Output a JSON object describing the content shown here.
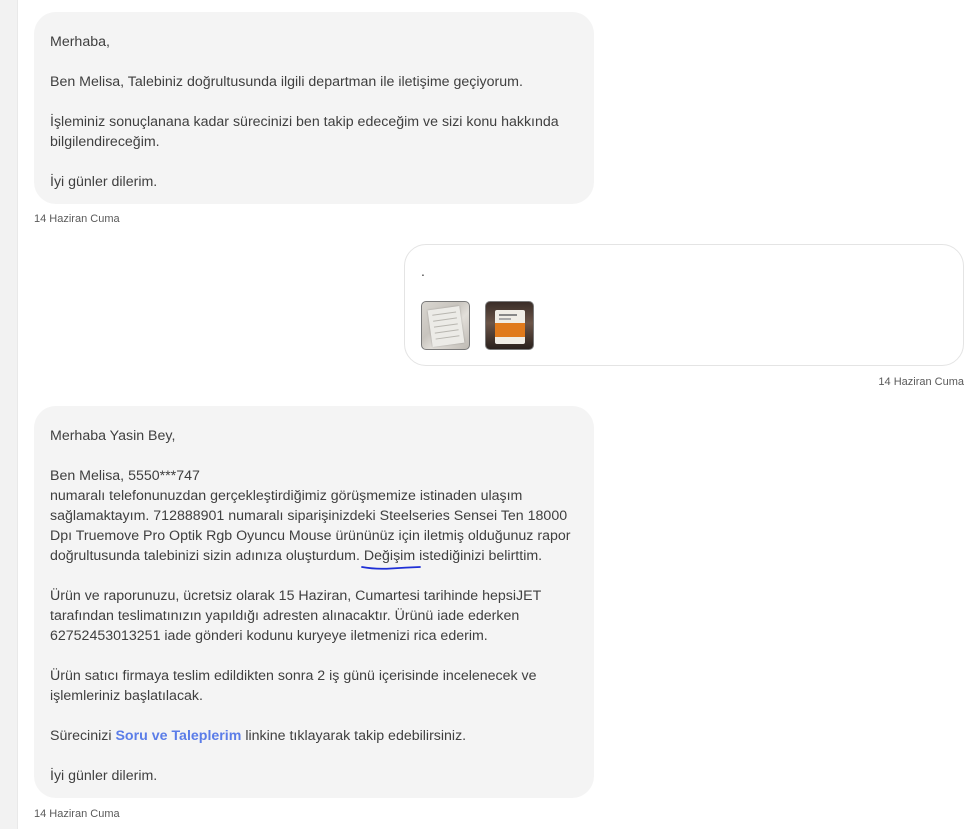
{
  "messages": [
    {
      "direction": "incoming",
      "paragraphs": [
        "Merhaba,",
        "Ben Melisa, Talebiniz doğrultusunda ilgili departman ile iletişime geçiyorum.",
        "İşleminiz sonuçlanana kadar sürecinizi ben takip edeceğim ve sizi konu hakkında bilgilendireceğim.",
        "İyi günler dilerim."
      ],
      "timestamp": "14 Haziran Cuma"
    },
    {
      "direction": "outgoing",
      "text": ".",
      "attachments": [
        {
          "icon": "document-photo-thumbnail"
        },
        {
          "icon": "product-box-photo-thumbnail"
        }
      ],
      "timestamp": "14 Haziran Cuma"
    },
    {
      "direction": "incoming",
      "greeting": "Merhaba Yasin Bey,",
      "para2": {
        "line1": "Ben Melisa, 5550***747",
        "body": "numaralı telefonunuzdan gerçekleştirdiğimiz görüşmemize istinaden ulaşım sağlamaktayım. 712888901 numaralı siparişinizdeki Steelseries Sensei Ten 18000 Dpı Truemove Pro Optik Rgb Oyuncu Mouse ürününüz için iletmiş olduğunuz rapor doğrultusunda talebinizi sizin adınıza oluşturdum.",
        "highlight": "Değişim",
        "tail": "istediğinizi belirttim."
      },
      "para3": "Ürün ve raporunuzu, ücretsiz olarak 15 Haziran, Cumartesi tarihinde hepsiJET tarafından teslimatınızın yapıldığı adresten alınacaktır. Ürünü iade ederken 62752453013251 iade gönderi kodunu kuryeye iletmenizi rica ederim.",
      "para4": "Ürün satıcı firmaya teslim edildikten sonra 2 iş günü içerisinde incelenecek ve işlemleriniz başlatılacak.",
      "para5": {
        "before": "Sürecinizi",
        "link": "Soru ve Taleplerim",
        "after": "linkine tıklayarak takip edebilirsiniz."
      },
      "closing": "İyi günler dilerim.",
      "timestamp": "14 Haziran Cuma"
    }
  ],
  "colors": {
    "incoming_bubble": "#f4f4f4",
    "link": "#5b7de8",
    "annotation_underline": "#1e2fd6"
  }
}
